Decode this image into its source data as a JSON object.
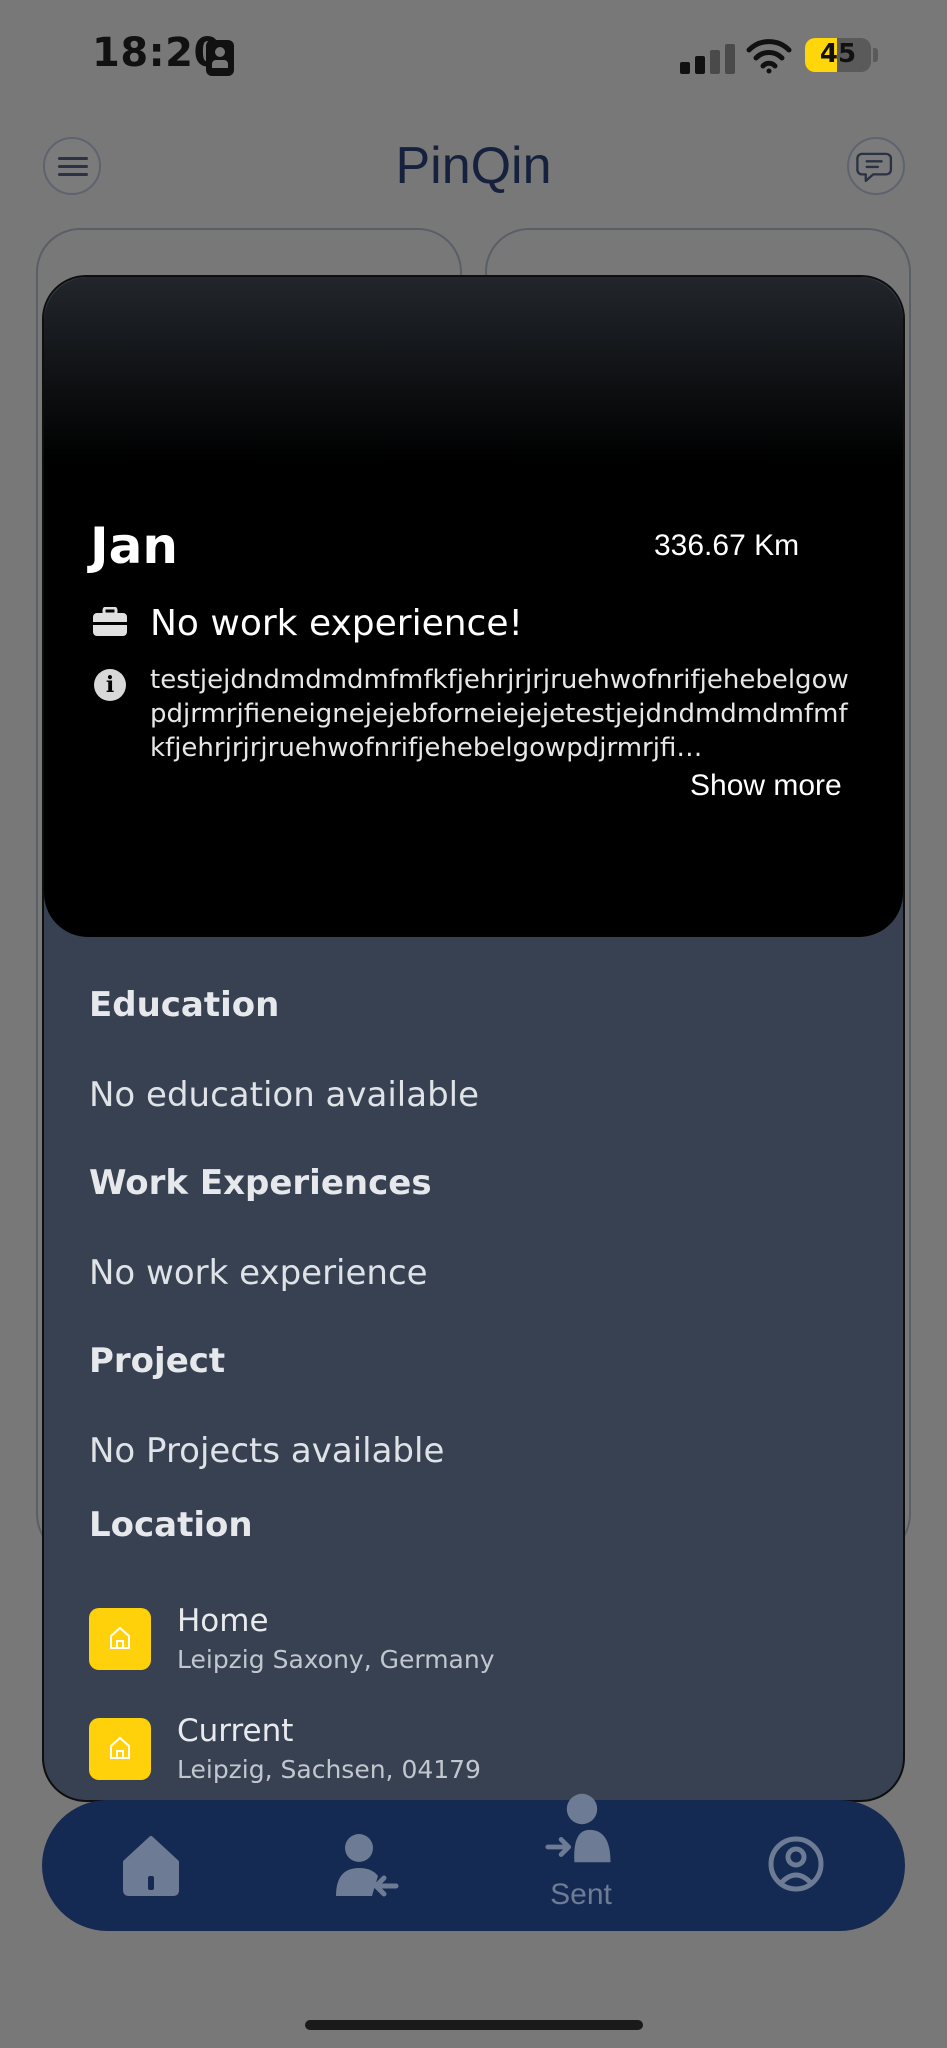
{
  "status_bar": {
    "time": "18:20",
    "battery": "45"
  },
  "header": {
    "title": "PinQin"
  },
  "profile": {
    "name": "Jan",
    "distance": "336.67 Km",
    "work_summary": "No work experience!",
    "bio": "testjejdndmdmdmfmfkfjehrjrjrjruehwofnrifjehebelgowpdjrmrjfieneignejejebforneiejejetestjejdndmdmdmfmfkfjehrjrjrjruehwofnrifjehebelgowpdjrmrjfi…",
    "show_more": "Show more",
    "sections": {
      "education_title": "Education",
      "education_text": "No education available",
      "work_title": "Work Experiences",
      "work_text": "No work experience",
      "project_title": "Project",
      "project_text": "No Projects available",
      "location_title": "Location"
    },
    "locations": [
      {
        "name": "Home",
        "address": "Leipzig Saxony, Germany"
      },
      {
        "name": "Current",
        "address": "Leipzig, Sachsen, 04179"
      }
    ]
  },
  "nav": {
    "sent_label": "Sent"
  },
  "icons": {
    "menu": "hamburger-menu-icon",
    "chat": "chat-bubble-icon",
    "work": "briefcase-icon",
    "info": "info-icon",
    "location": "house-icon",
    "nav_home": "home-icon",
    "nav_received": "person-incoming-icon",
    "nav_sent": "person-send-icon",
    "nav_profile": "user-circle-icon"
  },
  "colors": {
    "accent": "#ffd10a",
    "nav_bg": "#152a52",
    "card_bg": "#374151",
    "title": "#15213d"
  }
}
